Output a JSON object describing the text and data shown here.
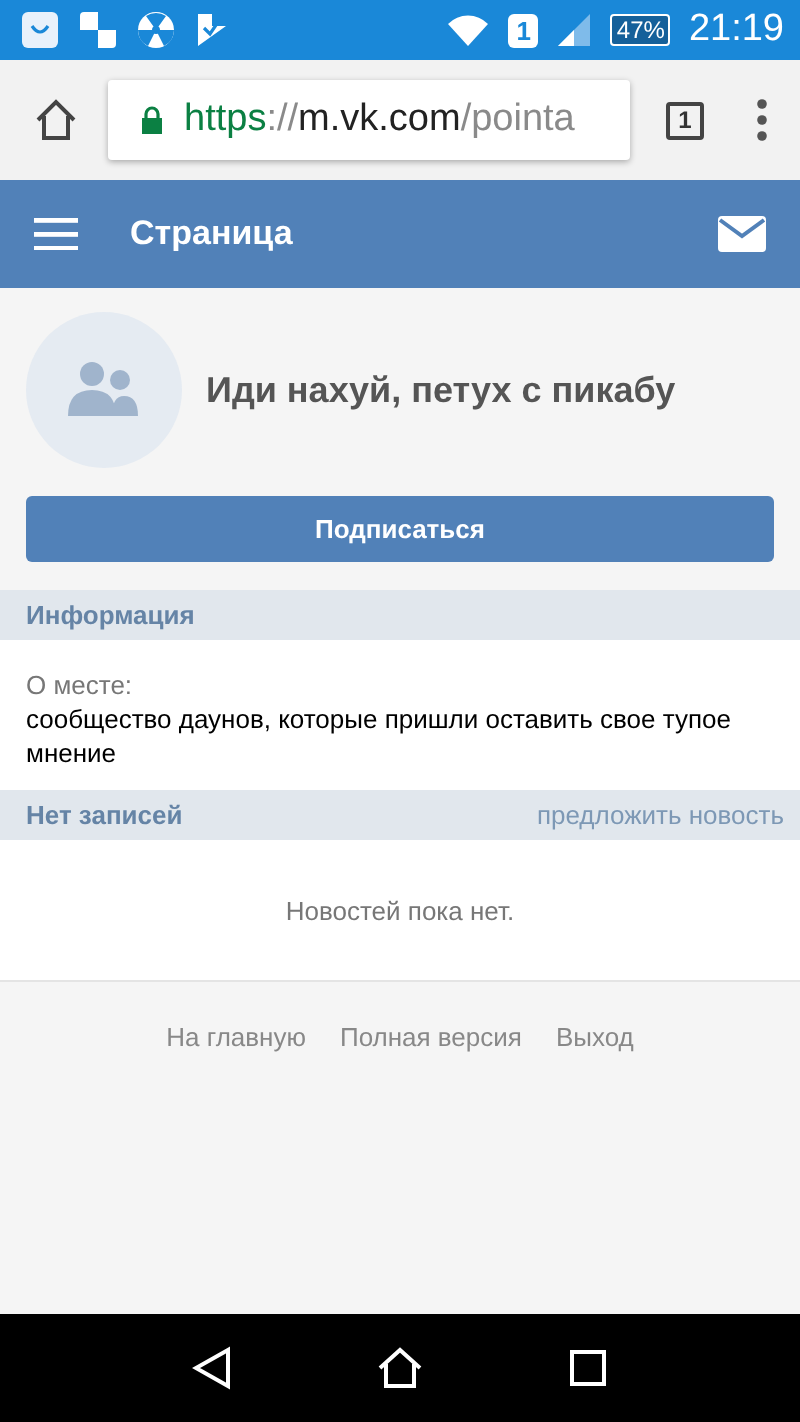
{
  "status_bar": {
    "sim": "1",
    "battery": "47%",
    "time": "21:19"
  },
  "browser": {
    "url": {
      "scheme": "https",
      "separator": "://",
      "host": "m.vk.com",
      "path": "/pointa"
    },
    "tab_count": "1"
  },
  "header": {
    "title": "Страница"
  },
  "profile": {
    "name": "Иди нахуй, петух с пикабу",
    "subscribe_button": "Подписаться"
  },
  "info": {
    "heading": "Информация",
    "label": "О месте:",
    "text": "сообщество даунов, которые пришли оставить свое тупое мнение"
  },
  "posts": {
    "heading": "Нет записей",
    "suggest_link": "предложить новость",
    "empty": "Новостей пока нет."
  },
  "footer": {
    "links": [
      "На главную",
      "Полная версия",
      "Выход"
    ]
  }
}
